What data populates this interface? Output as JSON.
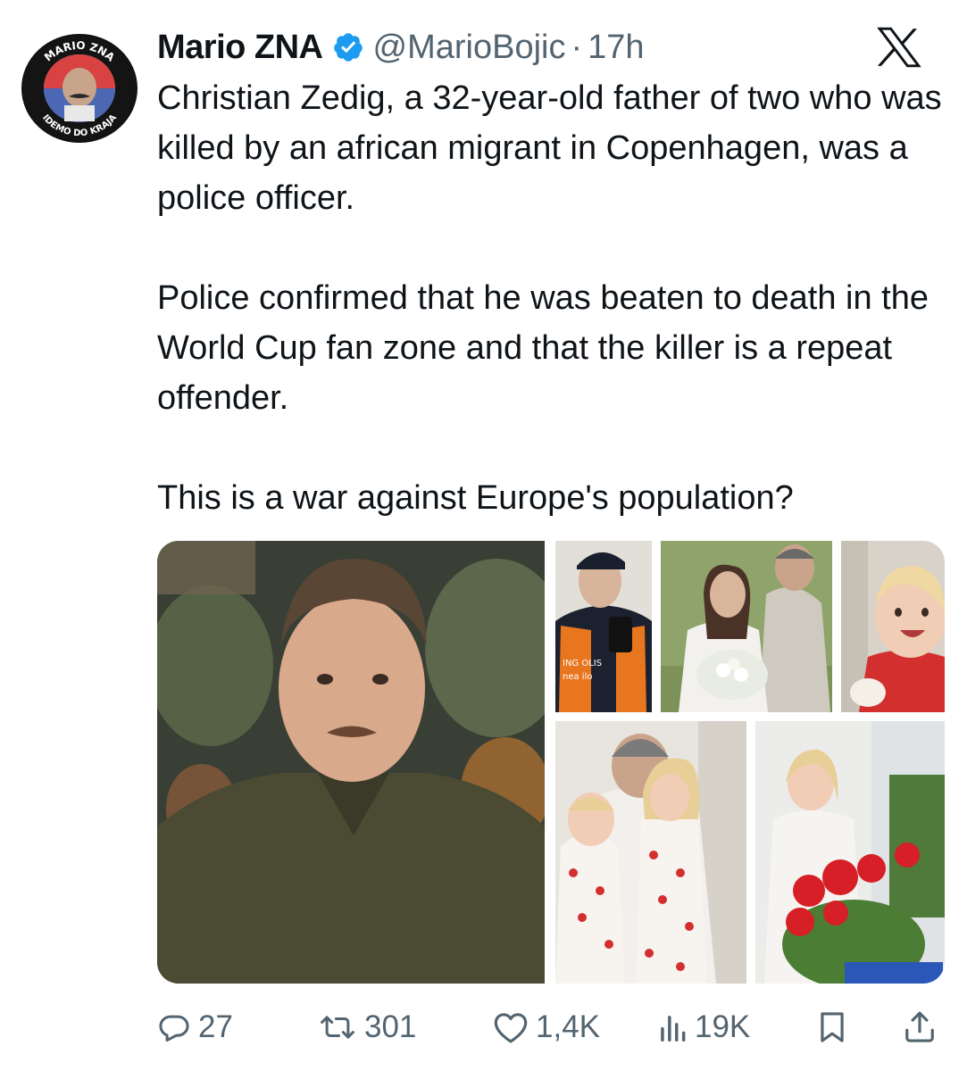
{
  "author": {
    "display_name": "Mario ZNA",
    "handle": "@MarioBojic",
    "separator": "·",
    "time": "17h",
    "verified": true,
    "avatar_text_top": "MARIO ZNA",
    "avatar_text_bottom": "IDEMO DO KRAJA"
  },
  "platform_icon": "x-logo",
  "tweet": {
    "paragraphs": [
      "Christian Zedig, a 32-year-old father of two who was killed by an african migrant in Copenhagen, was a police officer.",
      "Police confirmed that he was beaten to death in the World Cup fan zone and that the killer is a repeat offender.",
      "This is a war against Europe's population?"
    ]
  },
  "media": {
    "images": [
      {
        "name": "portrait-man-olive-shirt"
      },
      {
        "name": "police-officer-selfie",
        "vest_text_1": "ING OLIS",
        "vest_text_2": "nea ilo"
      },
      {
        "name": "wedding-photo"
      },
      {
        "name": "toddler-smiling"
      },
      {
        "name": "father-with-two-daughters"
      },
      {
        "name": "girl-with-red-flowers"
      }
    ]
  },
  "actions": {
    "reply": {
      "icon": "reply-icon",
      "count": "27"
    },
    "repost": {
      "icon": "repost-icon",
      "count": "301"
    },
    "like": {
      "icon": "heart-icon",
      "count": "1,4K"
    },
    "views": {
      "icon": "views-icon",
      "count": "19K"
    },
    "bookmark": {
      "icon": "bookmark-icon"
    },
    "share": {
      "icon": "share-icon"
    }
  },
  "colors": {
    "verified_blue": "#1d9bf0",
    "secondary_text": "#536471",
    "primary_text": "#0f1419"
  }
}
